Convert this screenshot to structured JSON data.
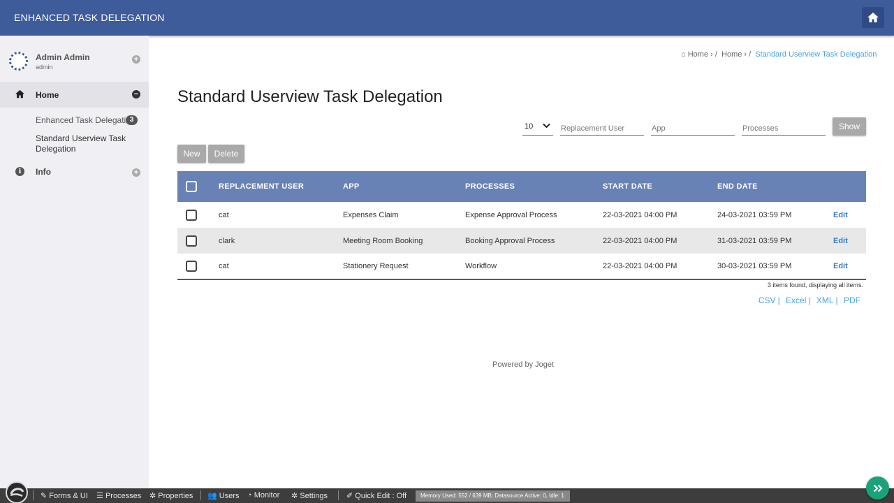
{
  "header": {
    "title": "ENHANCED TASK DELEGATION",
    "home_icon": "home-icon"
  },
  "sidebar": {
    "profile": {
      "name": "Admin Admin",
      "username": "admin"
    },
    "menu": {
      "home_label": "Home",
      "items": [
        {
          "label": "Enhanced Task Delegation",
          "badge": "3"
        },
        {
          "label": "Standard Userview Task Delegation"
        }
      ],
      "info_label": "Info"
    }
  },
  "breadcrumb": {
    "items": [
      "Home",
      "Home"
    ],
    "current": "Standard Userview Task Delegation"
  },
  "page": {
    "title": "Standard Userview Task Delegation"
  },
  "filters": {
    "page_size": "10",
    "replacement_user_placeholder": "Replacement User",
    "app_placeholder": "App",
    "processes_placeholder": "Processes",
    "show_label": "Show"
  },
  "actions": {
    "new_label": "New",
    "delete_label": "Delete"
  },
  "table": {
    "columns": [
      "REPLACEMENT USER",
      "APP",
      "PROCESSES",
      "START DATE",
      "END DATE"
    ],
    "rows": [
      {
        "user": "cat",
        "app": "Expenses Claim",
        "process": "Expense Approval Process",
        "start": "22-03-2021 04:00 PM",
        "end": "24-03-2021 03:59 PM",
        "action": "Edit"
      },
      {
        "user": "clark",
        "app": "Meeting Room Booking",
        "process": "Booking Approval Process",
        "start": "22-03-2021 04:00 PM",
        "end": "31-03-2021 03:59 PM",
        "action": "Edit"
      },
      {
        "user": "cat",
        "app": "Stationery Request",
        "process": "Workflow",
        "start": "22-03-2021 04:00 PM",
        "end": "30-03-2021 03:59 PM",
        "action": "Edit"
      }
    ],
    "summary": "3 items found, displaying all items.",
    "exports": [
      "CSV",
      "Excel",
      "XML",
      "PDF"
    ]
  },
  "footer": {
    "powered_by": "Powered by Joget"
  },
  "bottombar": {
    "items": [
      "Forms & UI",
      "Processes",
      "Properties",
      "Users",
      "Monitor",
      "Settings",
      "Quick Edit : Off"
    ],
    "memory": "Memory Used: 552 / 639 MB; Datasource Active: 0, Idle: 1"
  },
  "colors": {
    "header": "#3e5b9a",
    "table_header": "#6882b5",
    "link": "#4aa3df",
    "fab": "#1aa37a"
  }
}
